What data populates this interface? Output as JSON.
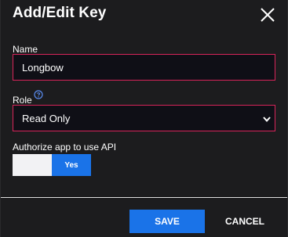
{
  "dialog": {
    "title": "Add/Edit Key",
    "close_icon": "close-icon"
  },
  "form": {
    "name": {
      "label": "Name",
      "value": "Longbow"
    },
    "role": {
      "label": "Role",
      "help_icon": "question-circle-icon",
      "selected": "Read Only"
    },
    "authorize": {
      "label": "Authorize app to use API",
      "state_label": "Yes",
      "enabled": true
    }
  },
  "actions": {
    "save_label": "SAVE",
    "cancel_label": "CANCEL"
  },
  "colors": {
    "background": "#1c1c1e",
    "field_border": "#d8245a",
    "field_background": "#0f0f16",
    "accent": "#1a73e8",
    "help_icon": "#5a8cf0"
  }
}
